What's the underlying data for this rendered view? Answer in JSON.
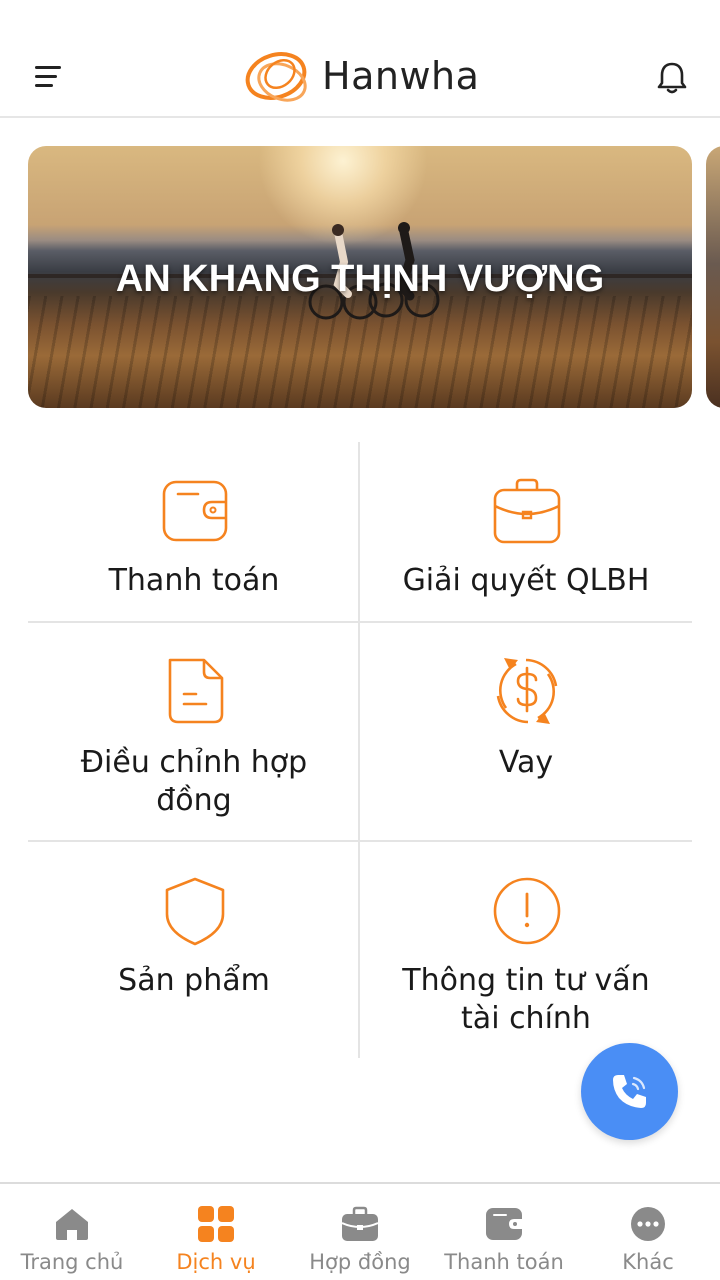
{
  "header": {
    "brand": "Hanwha",
    "menu_icon": "hamburger-menu-icon",
    "notification_icon": "bell-icon"
  },
  "banner": {
    "title": "AN KHANG THỊNH VƯỢNG"
  },
  "services": [
    {
      "label": "Thanh toán",
      "icon": "wallet-icon"
    },
    {
      "label": "Giải quyết QLBH",
      "icon": "briefcase-icon"
    },
    {
      "label": "Điều chỉnh hợp đồng",
      "icon": "document-icon"
    },
    {
      "label": "Vay",
      "icon": "dollar-exchange-icon"
    },
    {
      "label": "Sản phẩm",
      "icon": "shield-icon"
    },
    {
      "label": "Thông tin tư vấn tài chính",
      "icon": "info-circle-icon"
    }
  ],
  "floating_action": {
    "icon": "phone-icon"
  },
  "tabbar": {
    "tabs": [
      {
        "label": "Trang chủ",
        "icon": "home-icon"
      },
      {
        "label": "Dịch vụ",
        "icon": "grid-icon"
      },
      {
        "label": "Hợp đồng",
        "icon": "briefcase-icon"
      },
      {
        "label": "Thanh toán",
        "icon": "wallet-icon"
      },
      {
        "label": "Khác",
        "icon": "more-icon"
      }
    ],
    "active_index": 1
  },
  "colors": {
    "accent": "#f5831f",
    "call_button": "#4a8ef5",
    "inactive_tab": "#8a8a8a"
  }
}
